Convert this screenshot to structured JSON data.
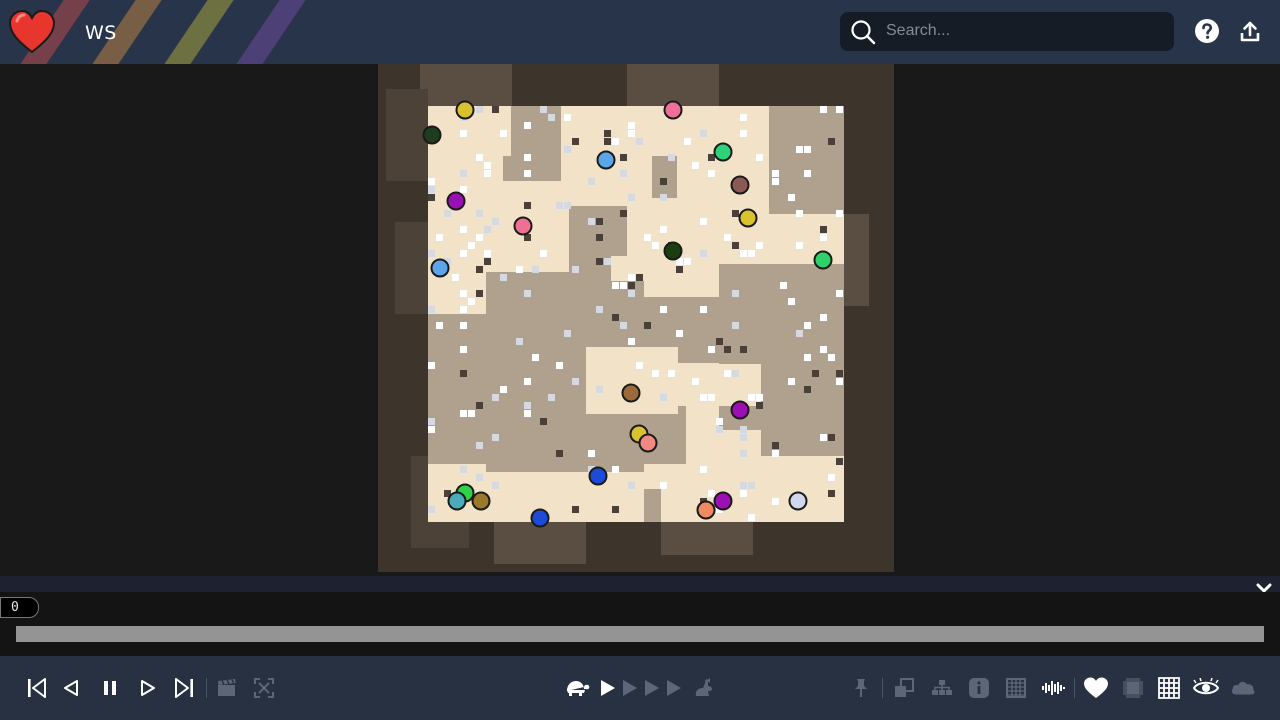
{
  "header": {
    "title": "WS",
    "search_placeholder": "Search..."
  },
  "icons": {
    "logo": "heart-logo",
    "search": "search-icon",
    "help": "help-icon",
    "share": "upload-share-icon",
    "collapse": "chevron-down-icon"
  },
  "colors": {
    "header_bg": "#273449",
    "toolbar_bg": "#273141",
    "world_bg": "#3d342c",
    "sand_light": "#f2e2c7",
    "sand_dark": "#b0a18e",
    "heart": "#e8352d",
    "scrubber": "#949494"
  },
  "timeline": {
    "frame": "0"
  },
  "toolbar": {
    "left": [
      "skip-to-start-icon",
      "step-back-icon",
      "pause-icon",
      "step-forward-icon",
      "skip-to-end-icon",
      "record-icon",
      "fullscreen-icon"
    ],
    "speed": [
      "turtle-slow-icon",
      "speed-1-icon",
      "speed-2-icon",
      "speed-3-icon",
      "speed-4-icon",
      "rabbit-fast-icon"
    ],
    "right": [
      "pin-icon",
      "overlay-icon",
      "tree-icon",
      "info-icon",
      "grid-dense-icon",
      "audio-icon",
      "heart-icon",
      "blur-icon",
      "grid-icon",
      "eye-icon",
      "cloud-icon"
    ]
  }
}
